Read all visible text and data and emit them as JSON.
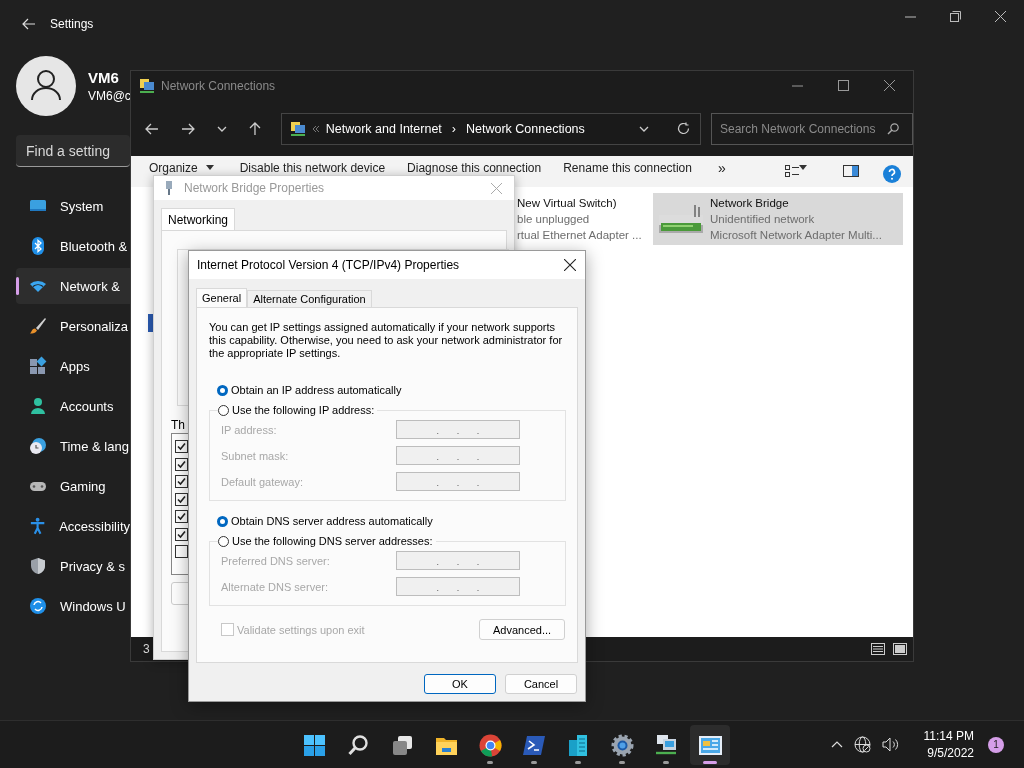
{
  "settings": {
    "title": "Settings",
    "user": {
      "name": "VM6",
      "email": "VM6@c"
    },
    "search": {
      "placeholder": "Find a setting"
    },
    "nav": [
      {
        "label": "System",
        "selected": false
      },
      {
        "label": "Bluetooth &",
        "selected": false
      },
      {
        "label": "Network &",
        "selected": true
      },
      {
        "label": "Personaliza",
        "selected": false
      },
      {
        "label": "Apps",
        "selected": false
      },
      {
        "label": "Accounts",
        "selected": false
      },
      {
        "label": "Time & lang",
        "selected": false
      },
      {
        "label": "Gaming",
        "selected": false
      },
      {
        "label": "Accessibility",
        "selected": false
      },
      {
        "label": "Privacy & s",
        "selected": false
      },
      {
        "label": "Windows U",
        "selected": false
      }
    ]
  },
  "explorer": {
    "title": "Network Connections",
    "address": [
      "Network and Internet",
      "Network Connections"
    ],
    "address_separator": "›",
    "search": {
      "placeholder": "Search Network Connections"
    },
    "commands": [
      "Organize",
      "Disable this network device",
      "Diagnose this connection",
      "Rename this connection"
    ],
    "more": "»",
    "items": [
      {
        "name": "New Virtual Switch)",
        "status": "ble unplugged",
        "device": "rtual Ethernet Adapter ...",
        "selected": false
      },
      {
        "name": "Network Bridge",
        "status": "Unidentified network",
        "device": "Microsoft Network Adapter Multi...",
        "selected": true
      }
    ],
    "status": "3"
  },
  "bridge": {
    "title": "Network Bridge Properties",
    "tab": "Networking",
    "list_label": "Th",
    "components": [
      {
        "checked": true
      },
      {
        "checked": true
      },
      {
        "checked": true
      },
      {
        "checked": true
      },
      {
        "checked": true
      },
      {
        "checked": true
      },
      {
        "checked": false
      }
    ]
  },
  "ipv4": {
    "title": "Internet Protocol Version 4 (TCP/IPv4) Properties",
    "tabs": [
      {
        "label": "General",
        "selected": true
      },
      {
        "label": "Alternate Configuration",
        "selected": false
      }
    ],
    "intro": "You can get IP settings assigned automatically if your network supports this capability. Otherwise, you need to ask your network administrator for the appropriate IP settings.",
    "ip_auto": {
      "label": "Obtain an IP address automatically",
      "selected": true
    },
    "ip_manual": {
      "label": "Use the following IP address:",
      "selected": false
    },
    "ip_fields": [
      {
        "label": "IP address:",
        "separators": [
          ".",
          ".",
          "."
        ],
        "disabled": true
      },
      {
        "label": "Subnet mask:",
        "separators": [
          ".",
          ".",
          "."
        ],
        "disabled": true
      },
      {
        "label": "Default gateway:",
        "separators": [
          ".",
          ".",
          "."
        ],
        "disabled": true
      }
    ],
    "dns_auto": {
      "label": "Obtain DNS server address automatically",
      "selected": true
    },
    "dns_manual": {
      "label": "Use the following DNS server addresses:",
      "selected": false
    },
    "dns_fields": [
      {
        "label": "Preferred DNS server:",
        "separators": [
          ".",
          ".",
          "."
        ],
        "disabled": true
      },
      {
        "label": "Alternate DNS server:",
        "separators": [
          ".",
          ".",
          "."
        ],
        "disabled": true
      }
    ],
    "validate": {
      "label": "Validate settings upon exit",
      "checked": false,
      "disabled": true
    },
    "advanced": "Advanced...",
    "ok": "OK",
    "cancel": "Cancel"
  },
  "taskbar": {
    "apps": [
      {
        "running": false,
        "active": false
      },
      {
        "running": false,
        "active": false
      },
      {
        "running": false,
        "active": false
      },
      {
        "running": false,
        "active": false
      },
      {
        "running": true,
        "active": false
      },
      {
        "running": true,
        "active": false
      },
      {
        "running": true,
        "active": false
      },
      {
        "running": true,
        "active": false
      },
      {
        "running": true,
        "active": false
      },
      {
        "running": true,
        "active": true
      }
    ],
    "time": "11:14 PM",
    "date": "9/5/2022",
    "notifications": "1"
  }
}
